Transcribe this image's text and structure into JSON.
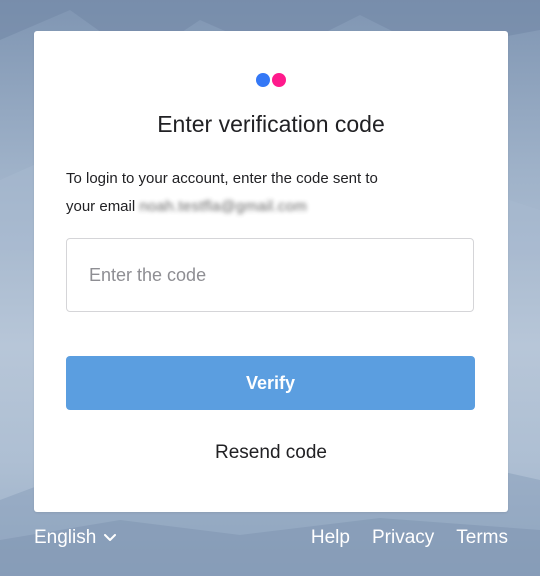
{
  "logo": {
    "icon": "flickr-dots-icon",
    "colors": {
      "blue": "#3478f6",
      "pink": "#ff1a8c"
    }
  },
  "card": {
    "title": "Enter verification code",
    "instruction_line1": "To login to your account, enter the code sent to",
    "instruction_line2_prefix": "your email",
    "email_redacted": "noah.testfla@gmail.com"
  },
  "form": {
    "code_placeholder": "Enter the code",
    "code_value": "",
    "verify_label": "Verify",
    "verify_color": "#5b9ee0",
    "resend_label": "Resend code"
  },
  "footer": {
    "language": "English",
    "language_icon": "chevron-down-icon",
    "links": [
      "Help",
      "Privacy",
      "Terms"
    ]
  },
  "background": {
    "description_color_top": "#7f95b2",
    "description_color_bottom": "#98acc5"
  }
}
